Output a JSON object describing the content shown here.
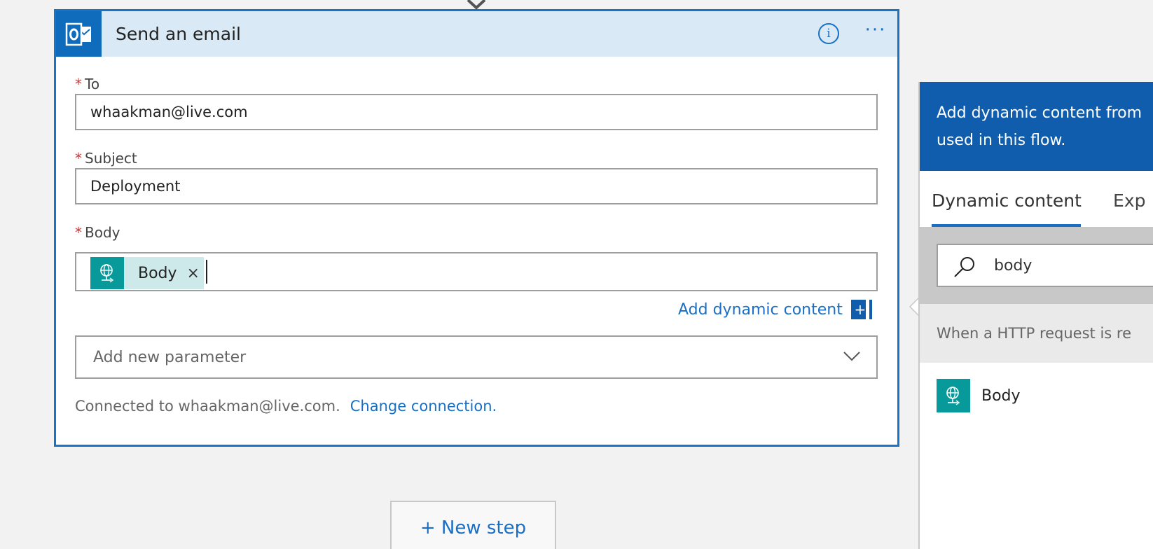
{
  "card": {
    "title": "Send an email",
    "info_label": "i",
    "more_label": "···",
    "to": {
      "label": "To",
      "required": "*",
      "value": "whaakman@live.com"
    },
    "subject": {
      "label": "Subject",
      "required": "*",
      "value": "Deployment"
    },
    "body": {
      "label": "Body",
      "required": "*",
      "token_label": "Body",
      "token_close": "×"
    },
    "add_dynamic_label": "Add dynamic content",
    "add_dynamic_plus": "+",
    "param_placeholder": "Add new parameter",
    "connected_text": "Connected to whaakman@live.com.",
    "change_connection": "Change connection."
  },
  "new_step_label": "+ New step",
  "panel": {
    "header_line1": "Add dynamic content from",
    "header_line2": "used in this flow.",
    "tabs": [
      {
        "label": "Dynamic content",
        "active": true
      },
      {
        "label": "Exp",
        "active": false
      }
    ],
    "search_value": "body",
    "section_header": "When a HTTP request is re",
    "results": [
      {
        "label": "Body",
        "icon": "http-request-icon"
      }
    ]
  },
  "colors": {
    "accent": "#1a6fc4",
    "header_bg": "#d9eaf6",
    "panel_header": "#0f5dac",
    "token_icon": "#089a9a",
    "token_bg": "#cde9ea",
    "required": "#d13438"
  }
}
